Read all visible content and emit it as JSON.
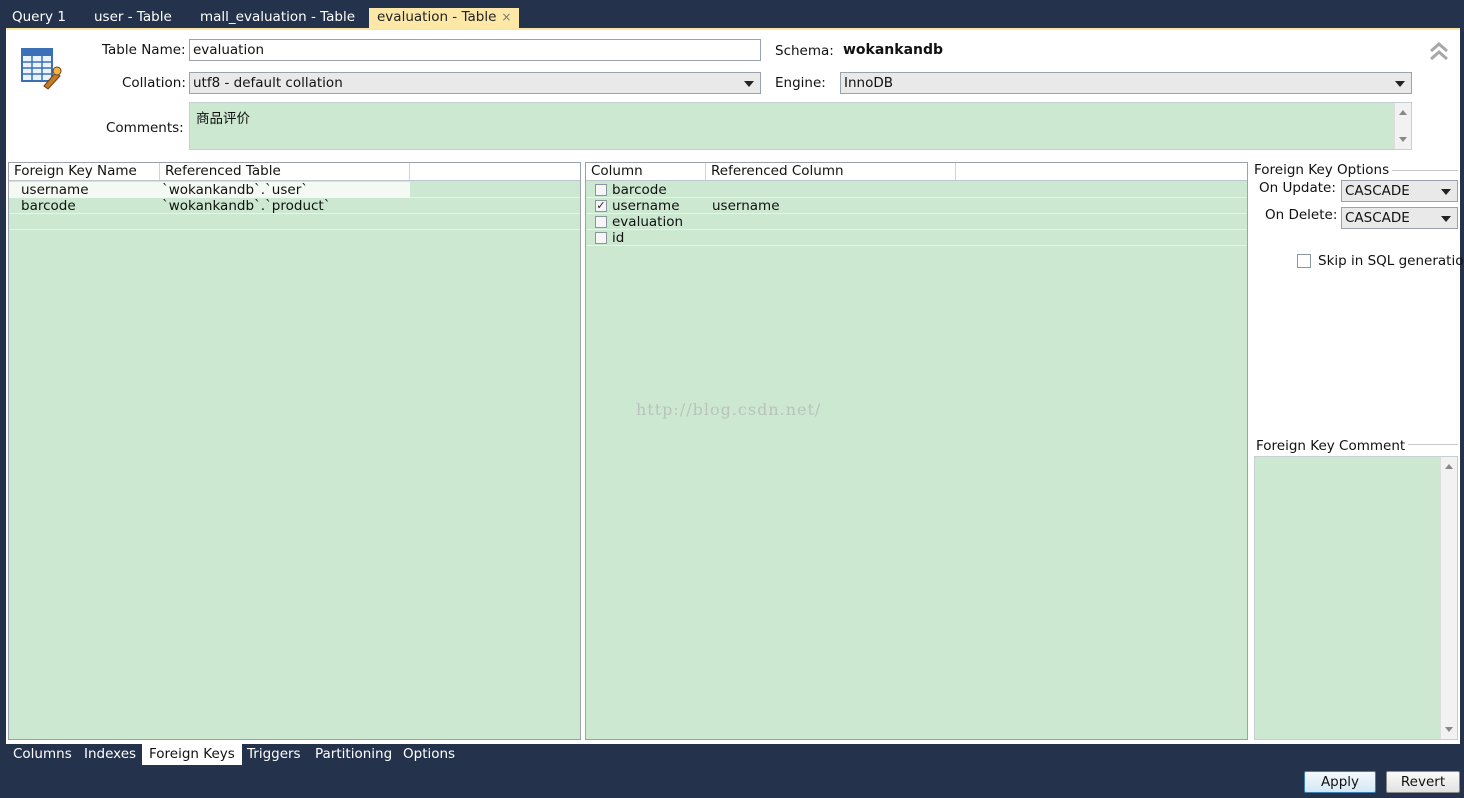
{
  "top_tabs": [
    {
      "label": "Query 1"
    },
    {
      "label": "user - Table"
    },
    {
      "label": "mall_evaluation - Table"
    },
    {
      "label": "evaluation - Table",
      "close": "×"
    }
  ],
  "form": {
    "table_name_label": "Table Name:",
    "table_name_value": "evaluation",
    "schema_label": "Schema:",
    "schema_value": "wokankandb",
    "collation_label": "Collation:",
    "collation_value": "utf8 - default collation",
    "engine_label": "Engine:",
    "engine_value": "InnoDB",
    "comments_label": "Comments:",
    "comments_value": "商品评价"
  },
  "fk_table": {
    "headers": [
      "Foreign Key Name",
      "Referenced Table"
    ],
    "rows": [
      {
        "name": "username",
        "ref": "`wokankandb`.`user`"
      },
      {
        "name": "barcode",
        "ref": "`wokankandb`.`product`"
      }
    ]
  },
  "column_table": {
    "headers": [
      "Column",
      "Referenced Column"
    ],
    "rows": [
      {
        "column": "barcode",
        "checked": false,
        "ref": ""
      },
      {
        "column": "username",
        "checked": true,
        "ref": "username",
        "mark": "✓"
      },
      {
        "column": "evaluation",
        "checked": false,
        "ref": ""
      },
      {
        "column": "id",
        "checked": false,
        "ref": ""
      }
    ]
  },
  "watermark": "http://blog.csdn.net/",
  "fk_options": {
    "title": "Foreign Key Options",
    "on_update_label": "On Update:",
    "on_update_value": "CASCADE",
    "on_delete_label": "On Delete:",
    "on_delete_value": "CASCADE",
    "skip_label": "Skip in SQL generation",
    "skip_checked": false,
    "comment_title": "Foreign Key Comment"
  },
  "bottom_tabs": [
    {
      "label": "Columns"
    },
    {
      "label": "Indexes"
    },
    {
      "label": "Foreign Keys",
      "active": true
    },
    {
      "label": "Triggers"
    },
    {
      "label": "Partitioning"
    },
    {
      "label": "Options"
    }
  ],
  "buttons": {
    "apply": "Apply",
    "revert": "Revert"
  },
  "colors": {
    "accent_tab": "#fde8a8",
    "grid_green": "#cce8d0",
    "chrome": "#24324b"
  }
}
